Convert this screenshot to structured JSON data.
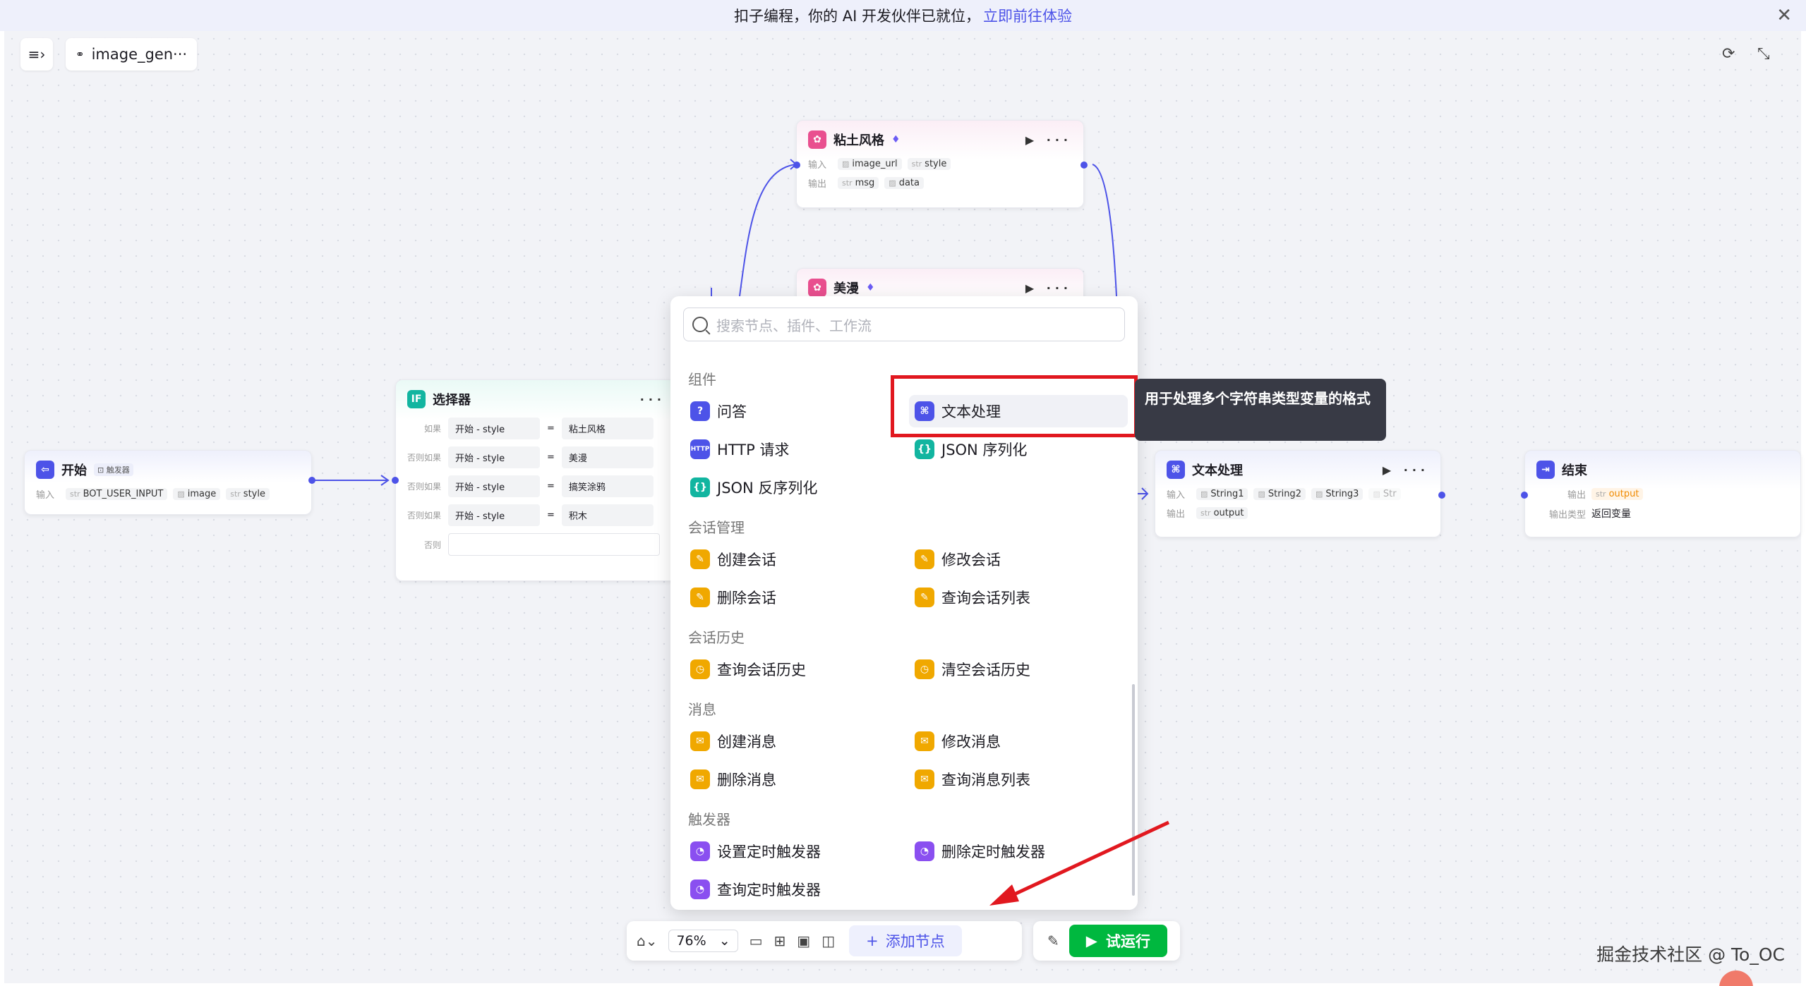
{
  "banner": {
    "text": "扣子编程，你的 AI 开发伙伴已就位，",
    "link": "立即前往体验",
    "close": "✕"
  },
  "header": {
    "title": "image_gen···",
    "menu_icon": "≡›",
    "refresh_icon": "⟳",
    "collapse_icon": "⤡"
  },
  "nodes": {
    "start": {
      "title": "开始",
      "badge": "⊡ 触发器",
      "input_label": "输入",
      "params": [
        "BOT_USER_INPUT",
        "image",
        "style"
      ]
    },
    "selector": {
      "title": "选择器",
      "rows": [
        {
          "label": "如果",
          "left": "开始 - style",
          "op": "=",
          "right": "粘土风格"
        },
        {
          "label": "否则如果",
          "left": "开始 - style",
          "op": "=",
          "right": "美漫"
        },
        {
          "label": "否则如果",
          "left": "开始 - style",
          "op": "=",
          "right": "搞笑涂鸦"
        },
        {
          "label": "否则如果",
          "left": "开始 - style",
          "op": "=",
          "right": "积木"
        }
      ],
      "else_label": "否则"
    },
    "clay": {
      "title": "粘土风格",
      "input_label": "输入",
      "output_label": "输出",
      "inputs": [
        "image_url",
        "style"
      ],
      "outputs": [
        "msg",
        "data"
      ]
    },
    "comic": {
      "title": "美漫"
    },
    "text_proc": {
      "title": "文本处理",
      "input_label": "输入",
      "output_label": "输出",
      "inputs": [
        "String1",
        "String2",
        "String3",
        "Str"
      ],
      "outputs": [
        "output"
      ]
    },
    "end": {
      "title": "结束",
      "output_label": "输出",
      "output_type_label": "输出类型",
      "output_var": "output",
      "output_type": "返回变量"
    }
  },
  "panel": {
    "search_placeholder": "搜索节点、插件、工作流",
    "categories": [
      {
        "name": "组件",
        "items": [
          "问答",
          "文本处理",
          "HTTP 请求",
          "JSON 序列化",
          "JSON 反序列化"
        ]
      },
      {
        "name": "会话管理",
        "items": [
          "创建会话",
          "修改会话",
          "删除会话",
          "查询会话列表"
        ]
      },
      {
        "name": "会话历史",
        "items": [
          "查询会话历史",
          "清空会话历史"
        ]
      },
      {
        "name": "消息",
        "items": [
          "创建消息",
          "修改消息",
          "删除消息",
          "查询消息列表"
        ]
      },
      {
        "name": "触发器",
        "items": [
          "设置定时触发器",
          "删除定时触发器",
          "查询定时触发器"
        ]
      }
    ],
    "tooltip": "用于处理多个字符串类型变量的格式"
  },
  "toolbar": {
    "zoom": "76%",
    "add_node": "添加节点",
    "run": "试运行"
  },
  "watermark": "掘金技术社区 @ To_OC",
  "colors": {
    "accent": "#4d53e8",
    "run": "#00b83f",
    "highlight": "#e1181f",
    "plugin": "#e94f8f",
    "chat": "#f0a800",
    "trigger": "#8a4ff0"
  }
}
